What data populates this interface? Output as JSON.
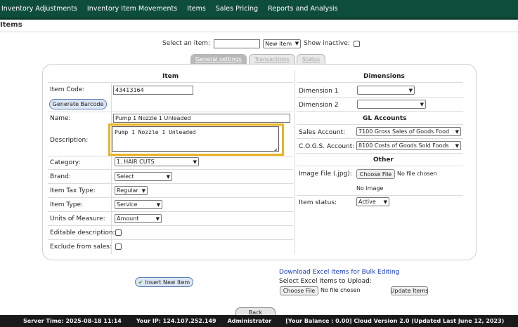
{
  "nav": [
    "Inventory Adjustments",
    "Inventory Item Movements",
    "Items",
    "Sales Pricing",
    "Reports and Analysis"
  ],
  "page_title": "Items",
  "select_item": {
    "label": "Select an item:",
    "value": "",
    "new_item": "New item",
    "show_inactive": "Show inactive:"
  },
  "tabs": [
    "General settings",
    "Transactions",
    "Status"
  ],
  "item": {
    "heading": "Item",
    "item_code_label": "Item Code:",
    "item_code": "43413164",
    "generate_barcode": "Generate Barcode",
    "name_label": "Name:",
    "name": "Pump 1 Nozzle 1 Unleaded",
    "description_label": "Description:",
    "description": "Pump 1 Nozzle 1 Unleaded",
    "category_label": "Category:",
    "category": "1. HAIR CUTS",
    "brand_label": "Brand:",
    "brand": "Select",
    "tax_label": "Item Tax Type:",
    "tax": "Regular",
    "type_label": "Item Type:",
    "type": "Service",
    "uom_label": "Units of Measure:",
    "uom": "Amount",
    "editable_label": "Editable description:",
    "exclude_label": "Exclude from sales:"
  },
  "dimensions": {
    "heading": "Dimensions",
    "dim1_label": "Dimension 1",
    "dim2_label": "Dimension 2",
    "dim1": "",
    "dim2": ""
  },
  "gl": {
    "heading": "GL Accounts",
    "sales_label": "Sales Account:",
    "sales": "7100   Gross Sales of Goods Food",
    "cogs_label": "C.O.G.S. Account:",
    "cogs": "8100   Costs of Goods Sold Foods"
  },
  "other": {
    "heading": "Other",
    "image_label": "Image File (.jpg):",
    "choose_file": "Choose File",
    "no_file": "No file chosen",
    "no_image": "No image",
    "status_label": "Item status:",
    "status": "Active"
  },
  "bulk": {
    "insert": "Insert New Item",
    "download": "Download Excel Items for Bulk Editing",
    "select_upload": "Select Excel Items to Upload:",
    "choose_file": "Choose File",
    "no_file": "No file chosen",
    "update": "Update Items",
    "back": "Back"
  },
  "footer": {
    "server_time": "Server Time: 2025-08-18 11:14",
    "ip": "Your IP: 124.107.252.149",
    "user": "Administrator",
    "balance": "[Your Balance : 0.00] Cloud Version 2.0 (Updated Last June 12, 2023)"
  },
  "colors": {
    "nav_bg": "#0f4d3b",
    "footer_bg": "#1a1a1a",
    "highlight": "#e8b422",
    "link": "#1a3fb0",
    "check_green": "#2e9b2e"
  }
}
